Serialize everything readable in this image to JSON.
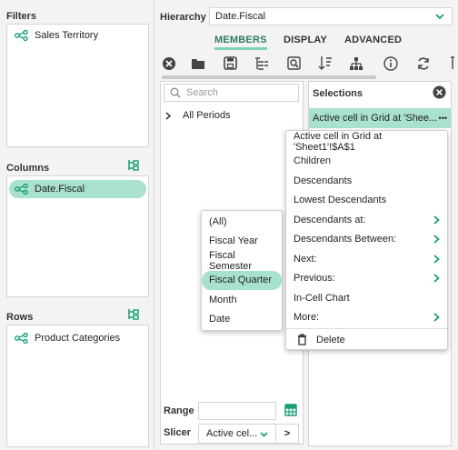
{
  "filters": {
    "title": "Filters",
    "items": [
      "Sales Territory"
    ]
  },
  "columns": {
    "title": "Columns",
    "items": [
      "Date.Fiscal"
    ]
  },
  "rows": {
    "title": "Rows",
    "items": [
      "Product Categories"
    ]
  },
  "hierarchy": {
    "label": "Hierarchy",
    "value": "Date.Fiscal"
  },
  "tabs": [
    "MEMBERS",
    "DISPLAY",
    "ADVANCED"
  ],
  "members": {
    "search_placeholder": "Search",
    "tree_item": "All Periods"
  },
  "selections": {
    "title": "Selections",
    "selected_item": "Active cell in Grid at 'Shee...",
    "more_dots": "•••"
  },
  "context_menu": {
    "items": [
      {
        "label": "Active cell in Grid at 'Sheet1'!$A$1",
        "submenu": false
      },
      {
        "label": "Children",
        "submenu": false
      },
      {
        "label": "Descendants",
        "submenu": false
      },
      {
        "label": "Lowest Descendants",
        "submenu": false
      },
      {
        "label": "Descendants at:",
        "submenu": true
      },
      {
        "label": "Descendants Between:",
        "submenu": true
      },
      {
        "label": "Next:",
        "submenu": true
      },
      {
        "label": "Previous:",
        "submenu": true
      },
      {
        "label": "In-Cell Chart",
        "submenu": false
      },
      {
        "label": "More:",
        "submenu": true
      }
    ],
    "delete_label": "Delete"
  },
  "levels_menu": {
    "items": [
      "(All)",
      "Fiscal Year",
      "Fiscal Semester",
      "Fiscal Quarter",
      "Month",
      "Date"
    ],
    "selected": "Fiscal Quarter"
  },
  "bottom": {
    "range_label": "Range",
    "slicer_label": "Slicer",
    "slicer_value": "Active cel...",
    "next_symbol": ">"
  },
  "colors": {
    "accent": "#7fd1b3",
    "accent_dark": "#1a9e77",
    "selection_bg": "#a8e1cc"
  }
}
